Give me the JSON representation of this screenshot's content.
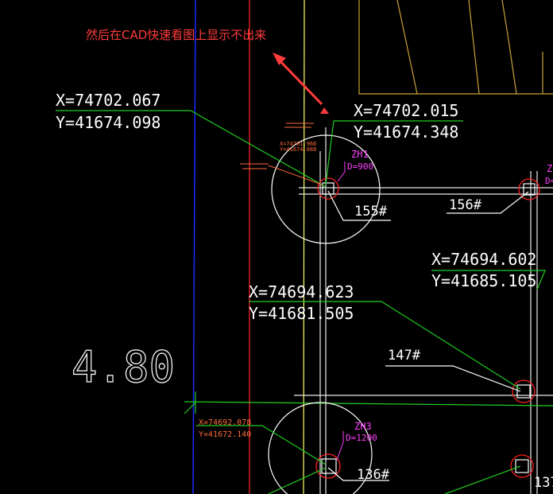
{
  "annotation": {
    "note": "然后在CAD快速看图上显示不出来",
    "color": "#ff3b3b"
  },
  "coordinates": [
    {
      "x": "X=74702.067",
      "y": "Y=41674.098"
    },
    {
      "x": "X=74702.015",
      "y": "Y=41674.348"
    },
    {
      "x": "X=74694.602",
      "y": "Y=41685.105"
    },
    {
      "x": "X=74694.623",
      "y": "Y=41681.505"
    },
    {
      "x": "X=74692.078",
      "y": "Y=41672.140"
    },
    {
      "x": "X=74701.966",
      "y": "Y=41674.088"
    }
  ],
  "piles": [
    {
      "label": "155#"
    },
    {
      "label": "156#"
    },
    {
      "label": "147#"
    },
    {
      "label": "136#"
    },
    {
      "label": "137"
    }
  ],
  "pile_tags": [
    {
      "name": "ZH1",
      "dia": "D=900"
    },
    {
      "name": "ZH3",
      "dia": "D=1200"
    },
    {
      "name": "Z",
      "dia": "D="
    }
  ],
  "elevation": "4.80",
  "colors": {
    "background": "#000000",
    "linework": "#ffffff",
    "leader": "#22cc22",
    "axis_blue": "#1a2bff",
    "axis_red": "#ff2a2a",
    "axis_yellow": "#ffff66",
    "pile_ring": "#ff2020",
    "tag": "#ff40ff",
    "small_text": "#ff6a3d",
    "border_tan": "#c8a23a"
  }
}
